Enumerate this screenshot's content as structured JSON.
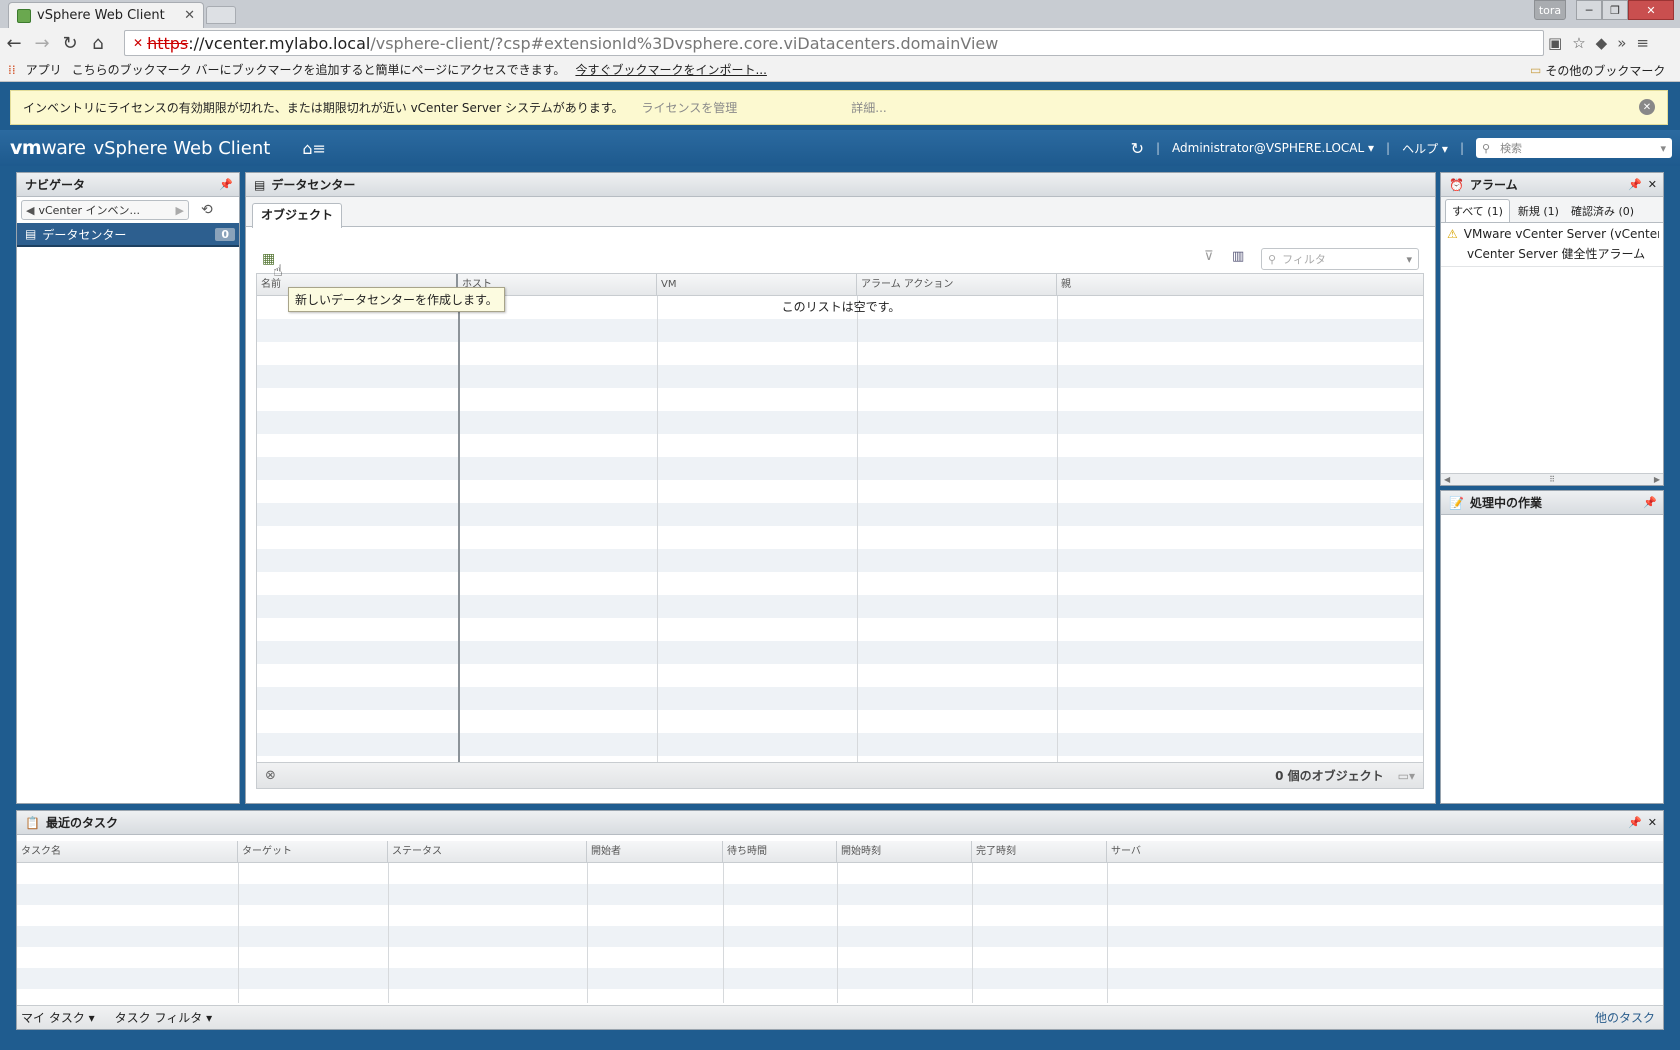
{
  "browser": {
    "tab_title": "vSphere Web Client",
    "user_badge": "tora",
    "url_scheme": "https",
    "url_host": "://vcenter.mylabo.local",
    "url_path": "/vsphere-client/?csp#extensionId%3Dvsphere.core.viDatacenters.domainView",
    "bookmarks": {
      "apps": "アプリ",
      "hint": "こちらのブックマーク バーにブックマークを追加すると簡単にページにアクセスできます。",
      "import_link": "今すぐブックマークをインポート...",
      "other": "その他のブックマーク"
    }
  },
  "notice": {
    "text": "インベントリにライセンスの有効期限が切れた、または期限切れが近い vCenter Server システムがあります。",
    "manage_link": "ライセンスを管理",
    "details_link": "詳細..."
  },
  "header": {
    "logo_vm": "vm",
    "logo_ware": "ware",
    "product": "vSphere Web Client",
    "user": "Administrator@VSPHERE.LOCAL",
    "help": "ヘルプ",
    "search_placeholder": "検索"
  },
  "navigator": {
    "title": "ナビゲータ",
    "back_label": "vCenter インベン...",
    "item_label": "データセンター",
    "item_count": "0"
  },
  "main": {
    "title": "データセンター",
    "tab": "オブジェクト",
    "filter_placeholder": "フィルタ",
    "tooltip": "新しいデータセンターを作成します。",
    "columns": [
      "名前",
      "ホスト",
      "VM",
      "アラーム アクション",
      "親"
    ],
    "empty_message": "このリストは空です。",
    "object_count": "0 個のオブジェクト"
  },
  "alarms": {
    "title": "アラーム",
    "tabs": [
      "すべて (1)",
      "新規 (1)",
      "確認済み (0)"
    ],
    "items": [
      {
        "source": "VMware vCenter Server (vCenter...",
        "name": "vCenter Server 健全性アラーム"
      }
    ]
  },
  "work": {
    "title": "処理中の作業"
  },
  "tasks": {
    "title": "最近のタスク",
    "columns": [
      "タスク名",
      "ターゲット",
      "ステータス",
      "開始者",
      "待ち時間",
      "開始時刻",
      "完了時刻",
      "サーバ"
    ],
    "footer_my_tasks": "マイ タスク",
    "footer_filter": "タスク フィルタ",
    "footer_more": "他のタスク"
  },
  "colors": {
    "app_blue": "#1f5c8f",
    "selection": "#2d5f8f",
    "notice_bg": "#fcf9d0"
  }
}
